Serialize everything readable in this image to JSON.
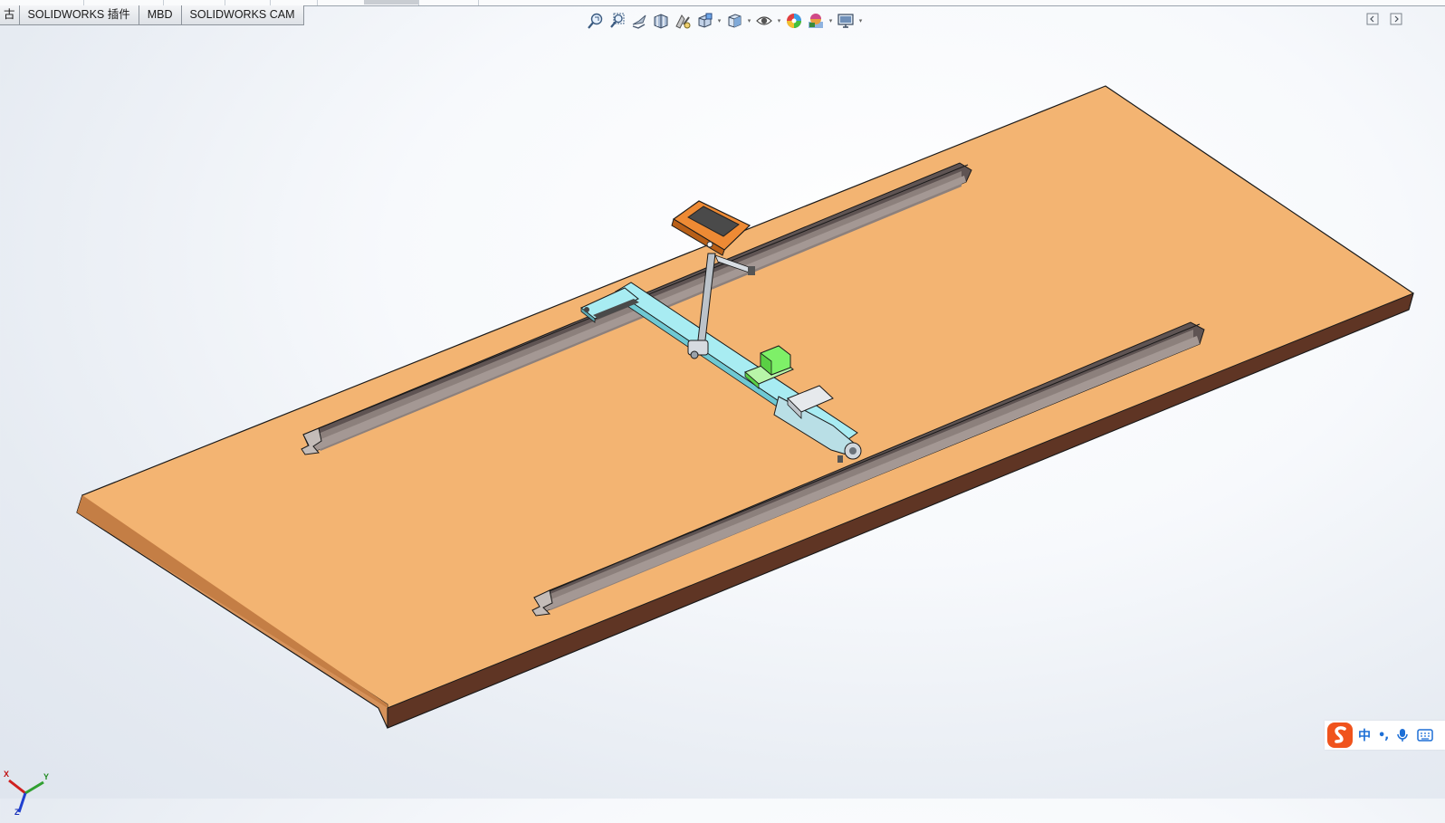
{
  "tabs": [
    {
      "label": "古"
    },
    {
      "label": "SOLIDWORKS 插件"
    },
    {
      "label": "MBD"
    },
    {
      "label": "SOLIDWORKS CAM"
    }
  ],
  "heads_up_toolbar": {
    "icons": [
      "zoom-to-fit-icon",
      "zoom-to-area-icon",
      "previous-view-icon",
      "section-view-icon",
      "dynamic-annotation-view-icon",
      "view-orientation-icon",
      "display-style-icon",
      "hide-show-items-icon",
      "edit-appearance-icon",
      "apply-scene-icon",
      "view-settings-icon"
    ]
  },
  "triad": {
    "x": "X",
    "y": "Y",
    "z": "Z"
  },
  "ime": {
    "language": "中",
    "punct": "•,"
  },
  "colors": {
    "plate_top": "#f3b472",
    "plate_side": "#d6925a",
    "plate_front": "#5f3524",
    "rail": "#8a7c78",
    "beam": "#a8ecf2",
    "motor_green": "#7ef068",
    "controller_orange": "#ee8a34",
    "ime_accent": "#1d6fd6"
  }
}
